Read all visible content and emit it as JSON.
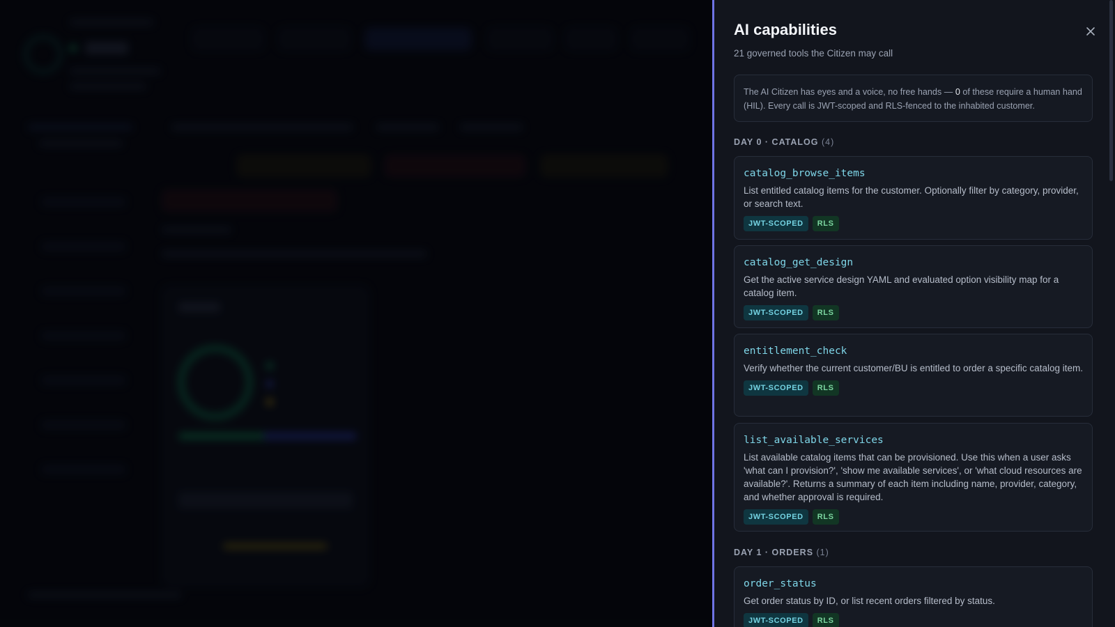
{
  "drawer": {
    "title": "AI capabilities",
    "subtitle": "21 governed tools the Citizen may call",
    "close_icon": "close-icon",
    "notice": {
      "before": "The AI Citizen has eyes and a voice, no free hands — ",
      "number": "0",
      "after": " of these require a human hand (HIL). Every call is JWT-scoped and RLS-fenced to the inhabited customer."
    },
    "sections": [
      {
        "label": "DAY 0 · CATALOG",
        "count": "(4)",
        "tools": [
          {
            "name": "catalog_browse_items",
            "description": "List entitled catalog items for the customer. Optionally filter by category, provider, or search text.",
            "tags": [
              "JWT-SCOPED",
              "RLS"
            ]
          },
          {
            "name": "catalog_get_design",
            "description": "Get the active service design YAML and evaluated option visibility map for a catalog item.",
            "tags": [
              "JWT-SCOPED",
              "RLS"
            ]
          },
          {
            "name": "entitlement_check",
            "description": "Verify whether the current customer/BU is entitled to order a specific catalog item.",
            "tags": [
              "JWT-SCOPED",
              "RLS"
            ]
          },
          {
            "name": "list_available_services",
            "description": "List available catalog items that can be provisioned. Use this when a user asks 'what can I provision?', 'show me available services', or 'what cloud resources are available?'. Returns a summary of each item including name, provider, category, and whether approval is required.",
            "tags": [
              "JWT-SCOPED",
              "RLS"
            ]
          }
        ]
      },
      {
        "label": "DAY 1 · ORDERS",
        "count": "(1)",
        "tools": [
          {
            "name": "order_status",
            "description": "Get order status by ID, or list recent orders filtered by status.",
            "tags": [
              "JWT-SCOPED",
              "RLS"
            ]
          }
        ]
      }
    ]
  },
  "colors": {
    "accent_border": "#6f74e4",
    "tool_name": "#7fd6e8",
    "tag_jwt_bg": "#0f3640",
    "tag_rls_bg": "#123624",
    "drawer_bg": "#12151d"
  }
}
